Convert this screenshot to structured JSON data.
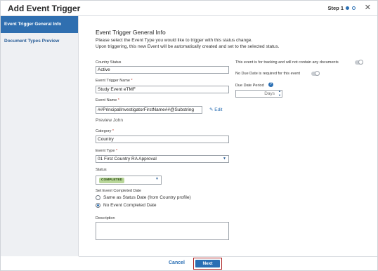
{
  "dialog": {
    "title": "Add Event Trigger",
    "step_label": "Step 1",
    "close_glyph": "✕"
  },
  "sidebar": {
    "items": [
      {
        "label": "Event Trigger General Info",
        "active": true
      },
      {
        "label": "Document Types Preview",
        "active": false
      }
    ]
  },
  "content": {
    "section_title": "Event Trigger General Info",
    "description_1": "Please select the Event Type you would like to trigger with this status change.",
    "description_2": "Upon triggering, this new Event will be automatically created and set to the selected status."
  },
  "form": {
    "country_status": {
      "label": "Country Status",
      "value": "Active"
    },
    "event_trigger_name": {
      "label": "Event Trigger Name",
      "value": "Study Event eTMF"
    },
    "event_name": {
      "label": "Event Name",
      "value": "##PrincipalInvestigatorFirstName##@Substring",
      "edit_label": "Edit"
    },
    "preview": {
      "value": "Preview John"
    },
    "category": {
      "label": "Category",
      "value": "Country"
    },
    "event_type": {
      "label": "Event Type",
      "value": "01 First Country RA Approval"
    },
    "status": {
      "label": "Status",
      "value": "COMPLETED"
    },
    "completed_date": {
      "label": "Set Event Completed Date",
      "options": [
        {
          "label": "Same as Status Date (from Country profile)",
          "selected": false
        },
        {
          "label": "No Event Completed Date",
          "selected": true
        }
      ]
    },
    "description": {
      "label": "Description",
      "value": ""
    },
    "required_mark": "*"
  },
  "right_panel": {
    "tracking_toggle_label": "This event is for tracking and will not contain any documents",
    "no_due_date_label": "No Due Date is required for this event",
    "due_date_period": {
      "label": "Due Date Period",
      "unit": "Days",
      "info_glyph": "?"
    }
  },
  "footer": {
    "cancel_label": "Cancel",
    "next_label": "Next"
  },
  "colors": {
    "accent": "#2a6fb4",
    "sidebar_active": "#2f6fb0",
    "status_badge": "#b9d79a",
    "highlight_border": "#b02a2a"
  }
}
